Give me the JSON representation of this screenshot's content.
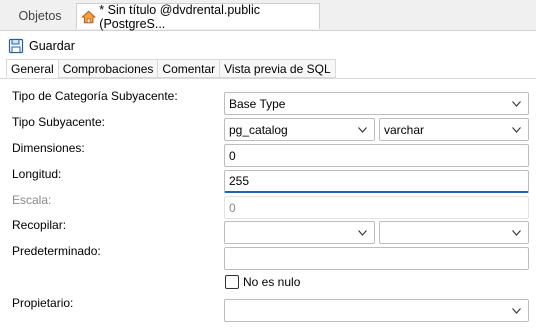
{
  "tabs": {
    "objects": "Objetos",
    "document": "* Sin título @dvdrental.public (PostgreS..."
  },
  "toolbar": {
    "save_label": "Guardar"
  },
  "prop_tabs": [
    "General",
    "Comprobaciones",
    "Comentar",
    "Vista previa de SQL"
  ],
  "form": {
    "category_label": "Tipo de Categoría Subyacente:",
    "category_value": "Base Type",
    "subtype_label": "Tipo Subyacente:",
    "schema_value": "pg_catalog",
    "type_value": "varchar",
    "dimensions_label": "Dimensiones:",
    "dimensions_value": "0",
    "length_label": "Longitud:",
    "length_value": "255",
    "scale_label": "Escala:",
    "scale_value": "0",
    "collation_label": "Recopilar:",
    "collation_schema_value": "",
    "collation_value": "",
    "default_label": "Predeterminado:",
    "default_value": "",
    "not_null_label": "No es nulo",
    "owner_label": "Propietario:",
    "owner_value": ""
  },
  "icons": [
    "home-icon",
    "save-icon",
    "chevron-down-icon"
  ],
  "colors": {
    "focus": "#1e64b4",
    "border": "#bdbdbd"
  }
}
